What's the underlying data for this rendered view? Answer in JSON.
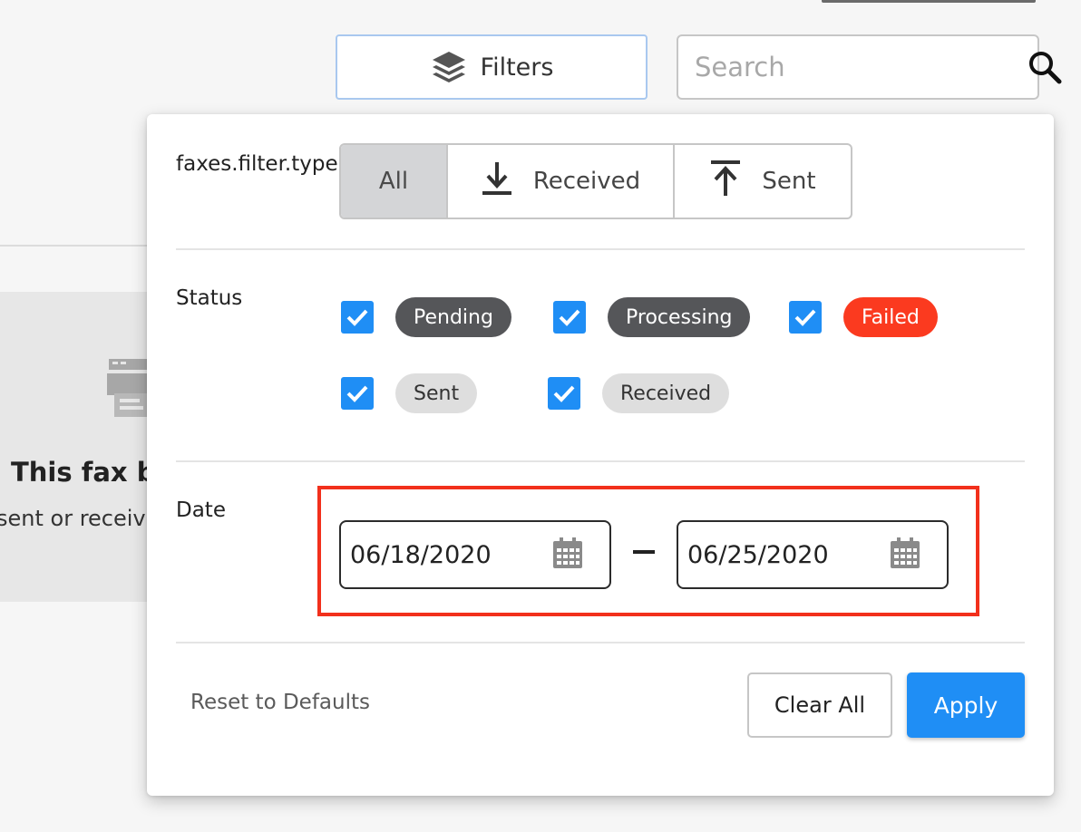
{
  "toolbar": {
    "filters_label": "Filters",
    "search_placeholder": "Search"
  },
  "empty_state": {
    "title": "This fax box",
    "subtitle": "sent or receive"
  },
  "filter_panel": {
    "type_label": "faxes.filter.type.",
    "type_options": [
      {
        "label": "All",
        "icon": "none",
        "active": true
      },
      {
        "label": "Received",
        "icon": "download-icon",
        "active": false
      },
      {
        "label": "Sent",
        "icon": "upload-icon",
        "active": false
      }
    ],
    "status_label": "Status",
    "statuses": [
      {
        "label": "Pending",
        "checked": true,
        "color": "#555659"
      },
      {
        "label": "Processing",
        "checked": true,
        "color": "#555659"
      },
      {
        "label": "Failed",
        "checked": true,
        "color": "#fb3a1f"
      },
      {
        "label": "Sent",
        "checked": true,
        "color": "#dedede"
      },
      {
        "label": "Received",
        "checked": true,
        "color": "#dedede"
      }
    ],
    "date_label": "Date",
    "date_from": "06/18/2020",
    "date_to": "06/25/2020",
    "reset_label": "Reset to Defaults",
    "clear_label": "Clear All",
    "apply_label": "Apply"
  },
  "colors": {
    "accent": "#1f8ef5",
    "highlight": "#f2301c",
    "failed": "#fb3a1f"
  }
}
